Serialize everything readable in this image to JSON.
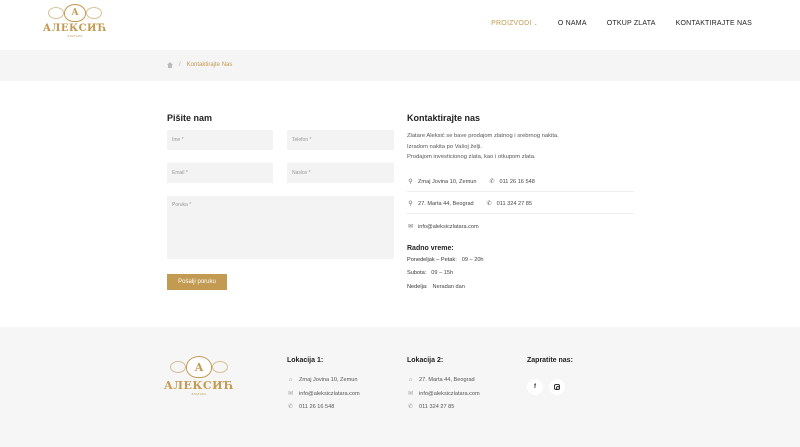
{
  "brand": {
    "monogram": "A",
    "name": "АЛЕКСИЋ",
    "tagline": "ЗЛАТАРА"
  },
  "nav": {
    "items": [
      {
        "label": "PROIZVODI",
        "has_dropdown": true
      },
      {
        "label": "O NAMA"
      },
      {
        "label": "OTKUP ZLATA"
      },
      {
        "label": "KONTAKTIRAJTE NAS"
      }
    ]
  },
  "breadcrumb": {
    "sep": "/",
    "current": "Kontaktirajte Nas"
  },
  "form": {
    "title": "Pišite nam",
    "name_placeholder": "Ime *",
    "phone_placeholder": "Telefon *",
    "email_placeholder": "Email *",
    "subject_placeholder": "Naslov *",
    "message_placeholder": "Poruka *",
    "submit_label": "Pošalji poruku"
  },
  "contact": {
    "title": "Kontaktirajte nas",
    "intro_lines": [
      "Zlatare Aleksić se bave prodajom zlatnog i srebrnog nakita.",
      "Izradom nakita po Vašoj želji.",
      "Prodajom investicionog zlata, kao i otkupom zlata."
    ],
    "location1_address": "Zmaj Jovina 10, Zemun",
    "location1_phone": "011 26 16 548",
    "location2_address": "27. Marta 44, Beograd",
    "location2_phone": "011 324 27 85",
    "email": "info@aleksiczlatara.com",
    "hours_title": "Radno vreme:",
    "hours": [
      {
        "day": "Ponedeljak – Petak:",
        "time": "09 – 20h"
      },
      {
        "day": "Subota:",
        "time": "09 – 15h"
      },
      {
        "day": "Nedelja:",
        "time": "Neradan dan"
      }
    ]
  },
  "footer": {
    "loc1_title": "Lokacija 1:",
    "loc1_address": "Zmaj Jovina 10, Zemun",
    "loc1_email": "info@aleksiczlatara.com",
    "loc1_phone": "011 26 16 548",
    "loc2_title": "Lokacija 2:",
    "loc2_address": "27. Marta 44, Beograd",
    "loc2_email": "info@aleksiczlatara.com",
    "loc2_phone": "011 324 27 85",
    "follow_title": "Zapratite nas:",
    "facebook_glyph": "f"
  },
  "icons": {
    "location": "map-marker-icon",
    "phone": "phone-icon",
    "email": "envelope-icon",
    "home": "home-icon"
  },
  "colors": {
    "accent": "#c29a52",
    "breadcrumb_bg": "#f5f5f5",
    "footer_bg": "#f6f6f6"
  }
}
